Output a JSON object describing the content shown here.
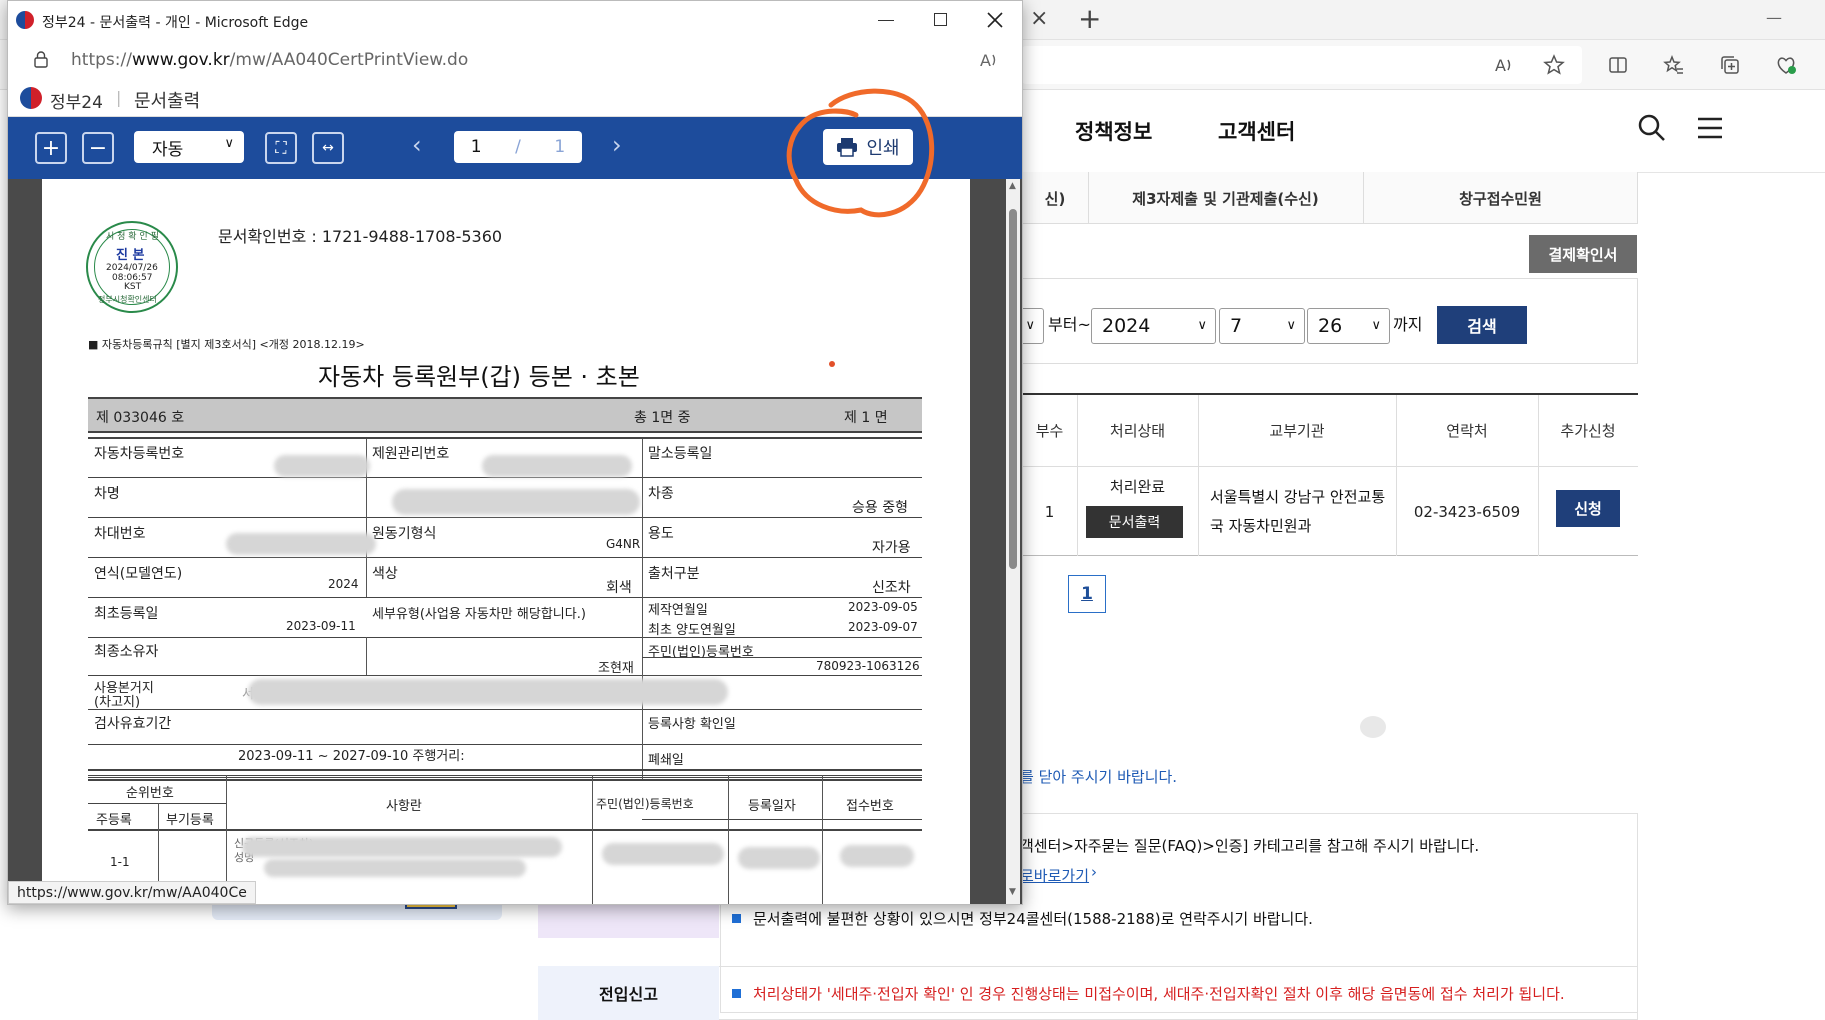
{
  "bg_browser": {
    "tab_close": "×",
    "new_tab": "+",
    "minimize": "—"
  },
  "bg_site": {
    "nav": [
      "정책정보",
      "고객센터"
    ],
    "tabs": [
      "신)",
      "제3자제출 및 기관제출(수신)",
      "창구접수민원"
    ],
    "payment_button": "결제확인서",
    "date_from_suffix": "부터~",
    "year": "2024",
    "month": "7",
    "day": "26",
    "date_to_suffix": "까지",
    "search_button": "검색",
    "table": {
      "headers": [
        "부수",
        "처리상태",
        "교부기관",
        "연락처",
        "추가신청"
      ],
      "row": {
        "copies": "1",
        "status": "처리완료",
        "print_button": "문서출력",
        "agency": "서울특별시 강남구 안전교통국 자동차민원과",
        "phone": "02-3423-6509",
        "apply_button": "신청"
      }
    },
    "page_number": "1",
    "notice_close": "를 닫아 주시기 바랍니다.",
    "faq_text": "객센터>자주묻는 질문(FAQ)>인증] 카테고리를 참고해 주시기 바랍니다.",
    "shortcut_link": "로바로가기",
    "callcenter_text": "문서출력에 불편한 상황이 있으시면 정부24콜센터(1588-2188)로 연락주시기 바랍니다.",
    "move_in_label": "전입신고",
    "move_in_text": "처리상태가 '세대주·전입자 확인' 인 경우 진행상태는 미접수이며, 세대주·전입자확인 절차 이후 해당 읍면동에 접수 처리가 됩니다."
  },
  "popup": {
    "window_title": "정부24 - 문서출력 - 개인 - Microsoft Edge",
    "url_prefix": "https://",
    "url_domain": "www.gov.kr",
    "url_path": "/mw/AA040CertPrintView.do",
    "site_name": "정부24",
    "page_name": "문서출력",
    "viewer": {
      "zoom_mode": "자동",
      "current_page": "1",
      "page_sep": "/",
      "total_pages": "1",
      "print_label": "인쇄"
    },
    "status_url": "https://www.gov.kr/mw/AA040Ce"
  },
  "document": {
    "confirm_label": "문서확인번호  :  1721-9488-1708-5360",
    "stamp": {
      "top": "시 청 확 인 필",
      "center": "진 본",
      "date": "2024/07/26",
      "time": "08:06:57",
      "tz": "KST",
      "bottom": "정부시청확인센터"
    },
    "regulation": "■  자동차등록규칙 [별지 제3호서식] <개정 2018.12.19>",
    "title": "자동차 등록원부(갑) 등본 · 초본",
    "header_no": "제      033046   호",
    "header_total": "총            1면      중",
    "header_page": "제    1  면",
    "fields": {
      "reg_no_label": "자동차등록번호",
      "mgmt_no_label": "제원관리번호",
      "cancel_date_label": "말소등록일",
      "car_name_label": "차명",
      "car_type_label": "차종",
      "car_type_value": "승용  중형",
      "vin_label": "차대번호",
      "engine_label": "원동기형식",
      "engine_value": "G4NR",
      "use_label": "용도",
      "use_value": "자가용",
      "model_year_label": "연식(모델연도)",
      "model_year_value": "2024",
      "color_label": "색상",
      "color_value": "회색",
      "origin_label": "출처구분",
      "origin_value": "신조차",
      "first_reg_label": "최초등록일",
      "first_reg_value": "2023-09-11",
      "detail_type_label": "세부유형(사업용 자동차만 해당합니다.)",
      "manufacture_label": "제작연월일",
      "manufacture_value": "2023-09-05",
      "first_transfer_label": "최초 양도연월일",
      "first_transfer_value": "2023-09-07",
      "owner_label": "최종소유자",
      "owner_value": "조현재",
      "resident_no_label": "주민(법인)등록번호",
      "resident_no_value": "780923-1063126",
      "base_label_1": "사용본거지",
      "base_label_2": "(차고지)",
      "base_value": "서",
      "inspect_label": "검사유효기간",
      "inspect_value": "2023-09-11  ~  2027-09-10    주행거리:",
      "confirm_date_label": "등록사항 확인일",
      "scrap_label": "폐쇄일"
    },
    "history_headers": {
      "seq": "순위번호",
      "main": "주등록",
      "sub": "부기등록",
      "item": "사항란",
      "resident": "주민(법인)등록번호",
      "date": "등록일자",
      "receipt": "접수번호"
    },
    "history_row": {
      "seq": "1-1",
      "item_1": "신규등록(신조차)",
      "item_2": "성명"
    }
  },
  "colors": {
    "viewer_bar": "#1d4c9c",
    "annotation": "#f06a2a",
    "navy": "#1f3f7a"
  }
}
